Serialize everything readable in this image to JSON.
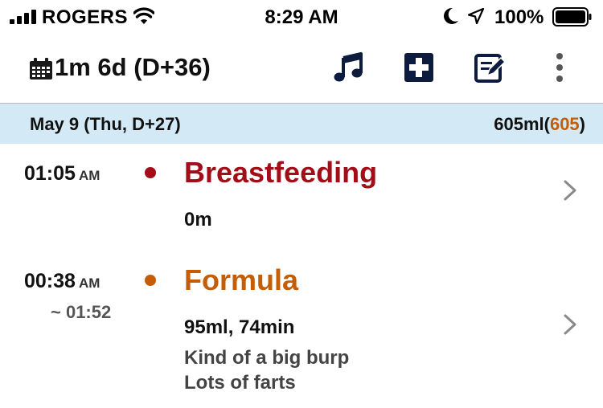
{
  "status_bar": {
    "carrier": "ROGERS",
    "time": "8:29 AM",
    "battery_pct": "100%",
    "signal_icon": "signal-bars-icon",
    "wifi_icon": "wifi-icon",
    "moon_icon": "do-not-disturb-moon-icon",
    "location_icon": "location-arrow-icon",
    "battery_icon": "battery-full-icon"
  },
  "nav": {
    "title": "1m 6d (D+36)",
    "calendar_icon": "calendar-icon",
    "actions": [
      "music-note-icon",
      "add-plus-icon",
      "edit-note-icon",
      "more-vertical-icon"
    ]
  },
  "day": {
    "label": "May 9 (Thu, D+27)",
    "total_prefix": "605ml(",
    "total_highlight": "605",
    "total_suffix": ")",
    "header_bg": "#d3e9f5"
  },
  "entries": [
    {
      "time": "01:05",
      "ampm": "AM",
      "title": "Breastfeeding",
      "detail": "0m",
      "color": "#a30d17"
    },
    {
      "time": "00:38",
      "ampm": "AM",
      "end_time": "~ 01:52",
      "title": "Formula",
      "detail": "95ml, 74min",
      "note_line1": "Kind of a big burp",
      "note_line2": "Lots of farts",
      "color": "#c55d06"
    }
  ],
  "colors": {
    "accent_orange": "#c55d06",
    "accent_red": "#a30d17",
    "icon_navy": "#0d1b3e"
  }
}
